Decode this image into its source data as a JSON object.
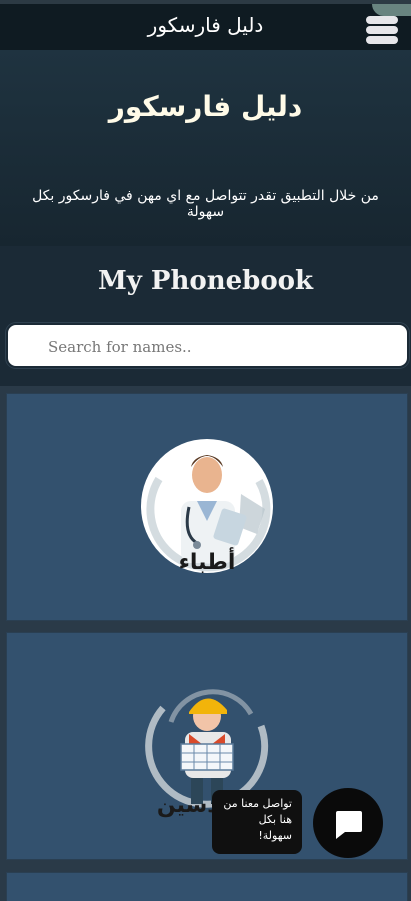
{
  "header": {
    "title": "دليل فارسكور",
    "menu_icon": "hamburger-icon"
  },
  "hero": {
    "title": "دليل فارسكور",
    "description": "من خلال التطبيق تقدر تتواصل مع اي مهن في فارسكور بكل سهولة"
  },
  "phonebook": {
    "title": "My Phonebook"
  },
  "search": {
    "placeholder": "Search for names.."
  },
  "cards": [
    {
      "label": "أطباء",
      "icon": "doctor-illustration"
    },
    {
      "label": "مهندسين",
      "icon": "engineer-illustration"
    }
  ],
  "chat": {
    "bubble_text": "تواصل معنا من هنا بكل سهولة!",
    "icon": "chat-icon"
  },
  "colors": {
    "background": "#1b2a36",
    "card": "#33516e",
    "topbar": "#0f1b22"
  }
}
